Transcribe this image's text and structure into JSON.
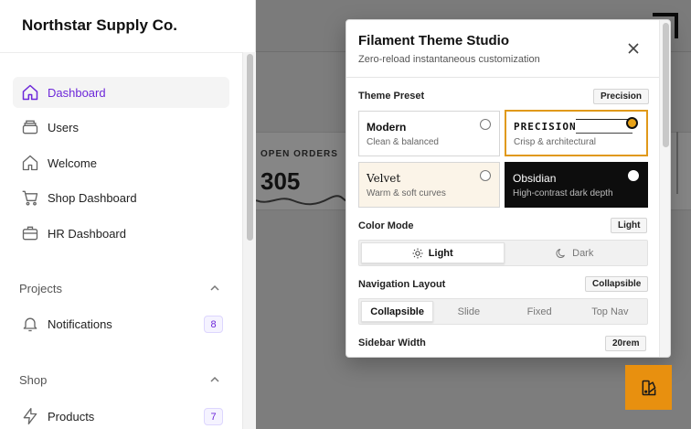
{
  "sidebar": {
    "brand": "Northstar Supply Co.",
    "items": [
      {
        "label": "Dashboard"
      },
      {
        "label": "Users"
      },
      {
        "label": "Welcome"
      },
      {
        "label": "Shop Dashboard"
      },
      {
        "label": "HR Dashboard"
      }
    ],
    "groups": [
      {
        "label": "Projects",
        "items": [
          {
            "label": "Notifications",
            "badge": "8"
          }
        ]
      },
      {
        "label": "Shop",
        "items": [
          {
            "label": "Products",
            "badge": "7"
          }
        ]
      }
    ]
  },
  "main": {
    "stat": {
      "label": "OPEN ORDERS",
      "value": "305"
    }
  },
  "modal": {
    "title": "Filament Theme Studio",
    "subtitle": "Zero-reload instantaneous customization",
    "theme_preset": {
      "label": "Theme Preset",
      "selected": "Precision",
      "options": [
        {
          "name": "Modern",
          "desc": "Clean & balanced"
        },
        {
          "name": "PRECISION",
          "desc": "Crisp & architectural"
        },
        {
          "name": "Velvet",
          "desc": "Warm & soft curves"
        },
        {
          "name": "Obsidian",
          "desc": "High-contrast dark depth"
        }
      ]
    },
    "color_mode": {
      "label": "Color Mode",
      "selected": "Light",
      "options": [
        "Light",
        "Dark"
      ]
    },
    "navigation_layout": {
      "label": "Navigation Layout",
      "selected": "Collapsible",
      "options": [
        "Collapsible",
        "Slide",
        "Fixed",
        "Top Nav"
      ]
    },
    "sidebar_width": {
      "label": "Sidebar Width",
      "value": "20rem"
    }
  },
  "colors": {
    "accent": "#6d28d9",
    "highlight": "#e0991a",
    "fab": "#e8900f"
  }
}
